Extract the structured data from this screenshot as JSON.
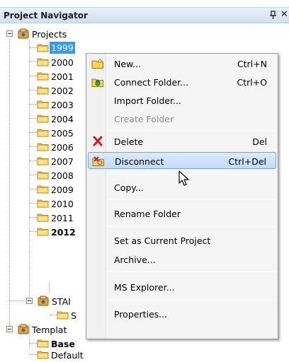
{
  "panel": {
    "title": "Project Navigator",
    "pin_icon": "pin-icon",
    "close_glyph": "✕"
  },
  "tree": {
    "root": "Projects",
    "years": [
      "1999",
      "2000",
      "2001",
      "2002",
      "2003",
      "2004",
      "2005",
      "2006",
      "2007",
      "2008",
      "2009",
      "2010",
      "2011",
      "2012"
    ],
    "selected": "1999",
    "standards": "STAI",
    "standards_child": "S",
    "templates": "Templat",
    "template_children": [
      "Base",
      "Default"
    ]
  },
  "context_menu": {
    "items": [
      {
        "label": "New...",
        "shortcut": "Ctrl+N",
        "icon": "new-folder-icon",
        "enabled": true
      },
      {
        "label": "Connect Folder...",
        "shortcut": "Ctrl+O",
        "icon": "connect-folder-icon",
        "enabled": true
      },
      {
        "label": "Import Folder...",
        "shortcut": "",
        "icon": "",
        "enabled": true
      },
      {
        "label": "Create Folder",
        "shortcut": "",
        "icon": "",
        "enabled": false
      },
      {
        "label": "Delete",
        "shortcut": "Del",
        "icon": "delete-x-icon",
        "enabled": true
      },
      {
        "label": "Disconnect",
        "shortcut": "Ctrl+Del",
        "icon": "disconnect-folder-icon",
        "enabled": true
      },
      {
        "label": "Copy...",
        "shortcut": "",
        "icon": "",
        "enabled": true
      },
      {
        "label": "Rename Folder",
        "shortcut": "",
        "icon": "",
        "enabled": true
      },
      {
        "label": "Set as Current Project",
        "shortcut": "",
        "icon": "",
        "enabled": true
      },
      {
        "label": "Archive...",
        "shortcut": "",
        "icon": "",
        "enabled": true
      },
      {
        "label": "MS Explorer...",
        "shortcut": "",
        "icon": "",
        "enabled": true
      },
      {
        "label": "Properties...",
        "shortcut": "",
        "icon": "",
        "enabled": true
      }
    ],
    "hovered": "Disconnect"
  },
  "colors": {
    "selection": "#3399ff",
    "folder": "#f7d35a",
    "hover_fill": "#c9e0fc",
    "delete_red": "#d11a1a"
  }
}
